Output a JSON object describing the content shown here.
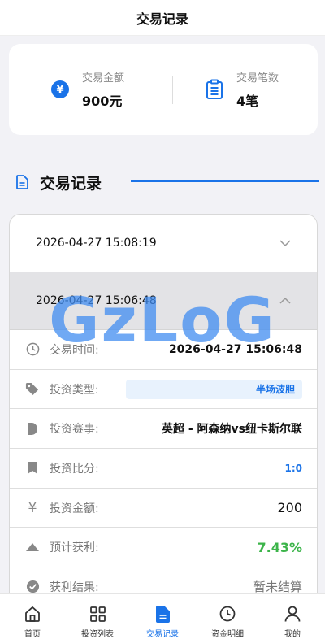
{
  "header": {
    "title": "交易记录"
  },
  "summary": {
    "amount": {
      "label": "交易金额",
      "value": "900元",
      "icon": "yen-circle-icon"
    },
    "count": {
      "label": "交易笔数",
      "value": "4笔",
      "icon": "clipboard-icon"
    }
  },
  "section": {
    "title": "交易记录",
    "icon": "document-icon"
  },
  "records": [
    {
      "time": "2026-04-27 15:08:19",
      "expanded": false
    },
    {
      "time": "2026-04-27 15:06:48",
      "expanded": true
    }
  ],
  "detail": {
    "trade_time": {
      "label": "交易时间:",
      "value": "2026-04-27 15:06:48"
    },
    "invest_type": {
      "label": "投资类型:",
      "value": "半场波胆"
    },
    "match": {
      "label": "投资赛事:",
      "value": "英超 - 阿森纳vs纽卡斯尔联"
    },
    "score": {
      "label": "投资比分:",
      "value": "1:0"
    },
    "amount": {
      "label": "投资金额:",
      "value": "200",
      "icon_glyph": "¥"
    },
    "expected_profit": {
      "label": "预计获利:",
      "value": "7.43%"
    },
    "result": {
      "label": "获利结果:",
      "value": "暂未结算"
    }
  },
  "watermark": "GzLoG",
  "tabbar": [
    {
      "label": "首页",
      "icon": "home-icon"
    },
    {
      "label": "投资列表",
      "icon": "grid-icon"
    },
    {
      "label": "交易记录",
      "icon": "document-icon",
      "active": true
    },
    {
      "label": "资金明细",
      "icon": "clock-icon"
    },
    {
      "label": "我的",
      "icon": "user-icon"
    }
  ],
  "colors": {
    "accent": "#1a73e8",
    "green": "#3cb44a",
    "background": "#f2f2f6"
  }
}
